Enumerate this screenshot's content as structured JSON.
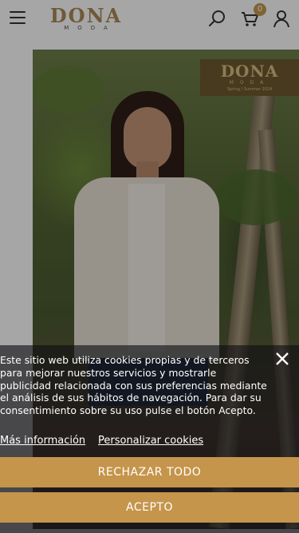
{
  "header": {
    "logo_brand": "DONA",
    "logo_sub": "MODA",
    "cart_count": "0",
    "icons": {
      "menu": "hamburger-menu-icon",
      "search": "search-icon",
      "cart": "cart-icon",
      "account": "user-icon"
    }
  },
  "hero": {
    "badge_brand": "DONA",
    "badge_sub": "MODA",
    "badge_season": "Spring / Summer 2024"
  },
  "cookies": {
    "message": "Este sitio web utiliza cookies propias y de terceros para mejorar nuestros servicios y mostrarle publicidad relacionada con sus preferencias mediante el análisis de sus hábitos de navegación. Para dar su consentimiento sobre su uso pulse el botón Acepto.",
    "more_info": "Más información",
    "customize": "Personalizar cookies",
    "reject_all": "RECHAZAR TODO",
    "accept": "ACEPTO"
  },
  "colors": {
    "accent": "#c5954b",
    "badge": "#c49a4f",
    "brand": "#a98a55"
  }
}
